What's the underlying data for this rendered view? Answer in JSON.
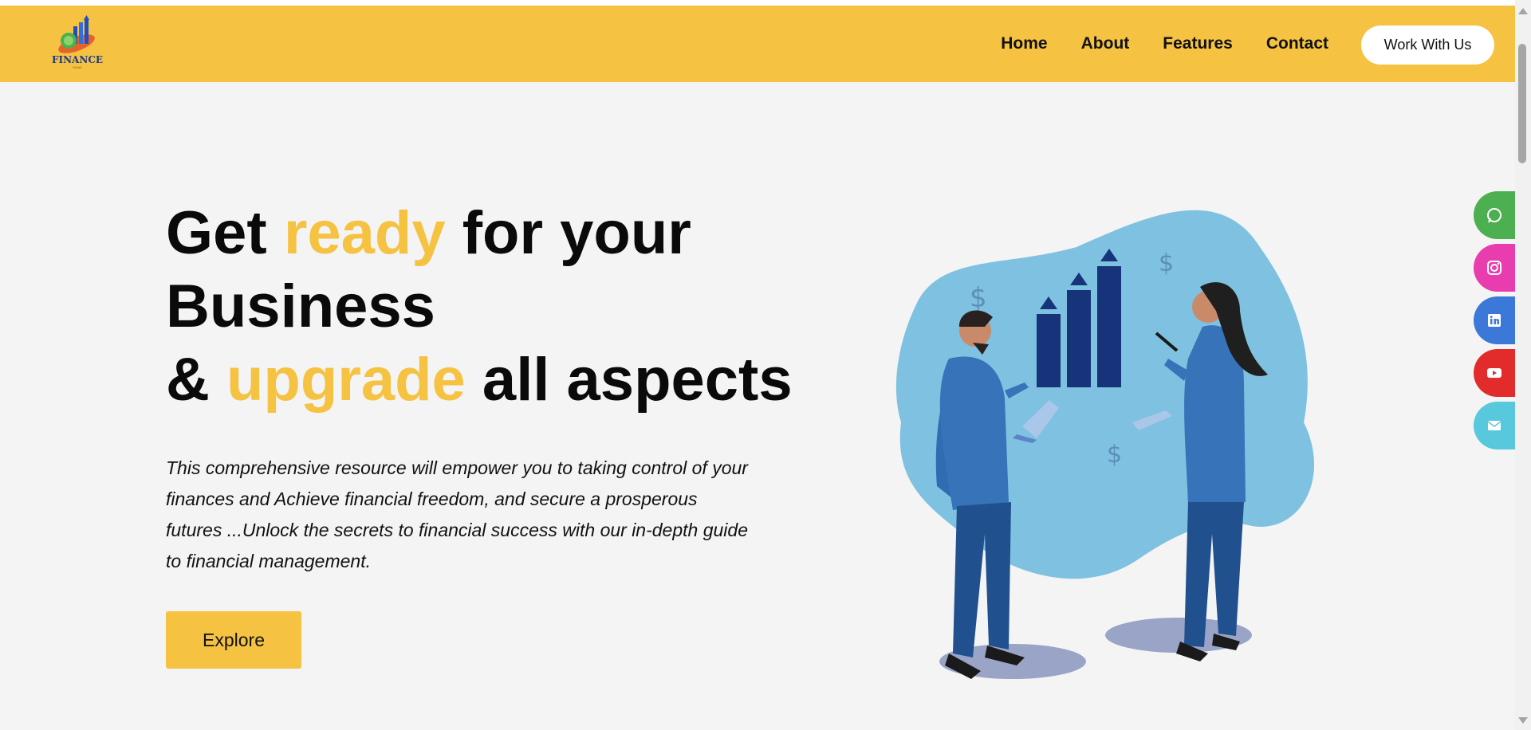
{
  "logo": {
    "text": "FINANCE",
    "sub": "HOME"
  },
  "nav": {
    "items": [
      "Home",
      "About",
      "Features",
      "Contact"
    ],
    "cta": "Work With Us"
  },
  "hero": {
    "title_part1": "Get ",
    "title_hl1": "ready",
    "title_part2": " for your",
    "title_line2": "Business",
    "title_part3": "& ",
    "title_hl2": "upgrade",
    "title_part4": " all aspects",
    "description": "This comprehensive resource will empower you to taking control of your finances and Achieve financial freedom, and secure a prosperous futures ...Unlock the secrets to financial success with our in-depth guide to financial management.",
    "button": "Explore"
  },
  "social": [
    {
      "name": "whatsapp",
      "color": "#4caf50"
    },
    {
      "name": "instagram",
      "color": "#e83caf"
    },
    {
      "name": "linkedin",
      "color": "#3b78d8"
    },
    {
      "name": "youtube",
      "color": "#e22b2b"
    },
    {
      "name": "email",
      "color": "#58c8dc"
    }
  ],
  "colors": {
    "accent": "#f5c242",
    "background": "#f4f4f4"
  }
}
